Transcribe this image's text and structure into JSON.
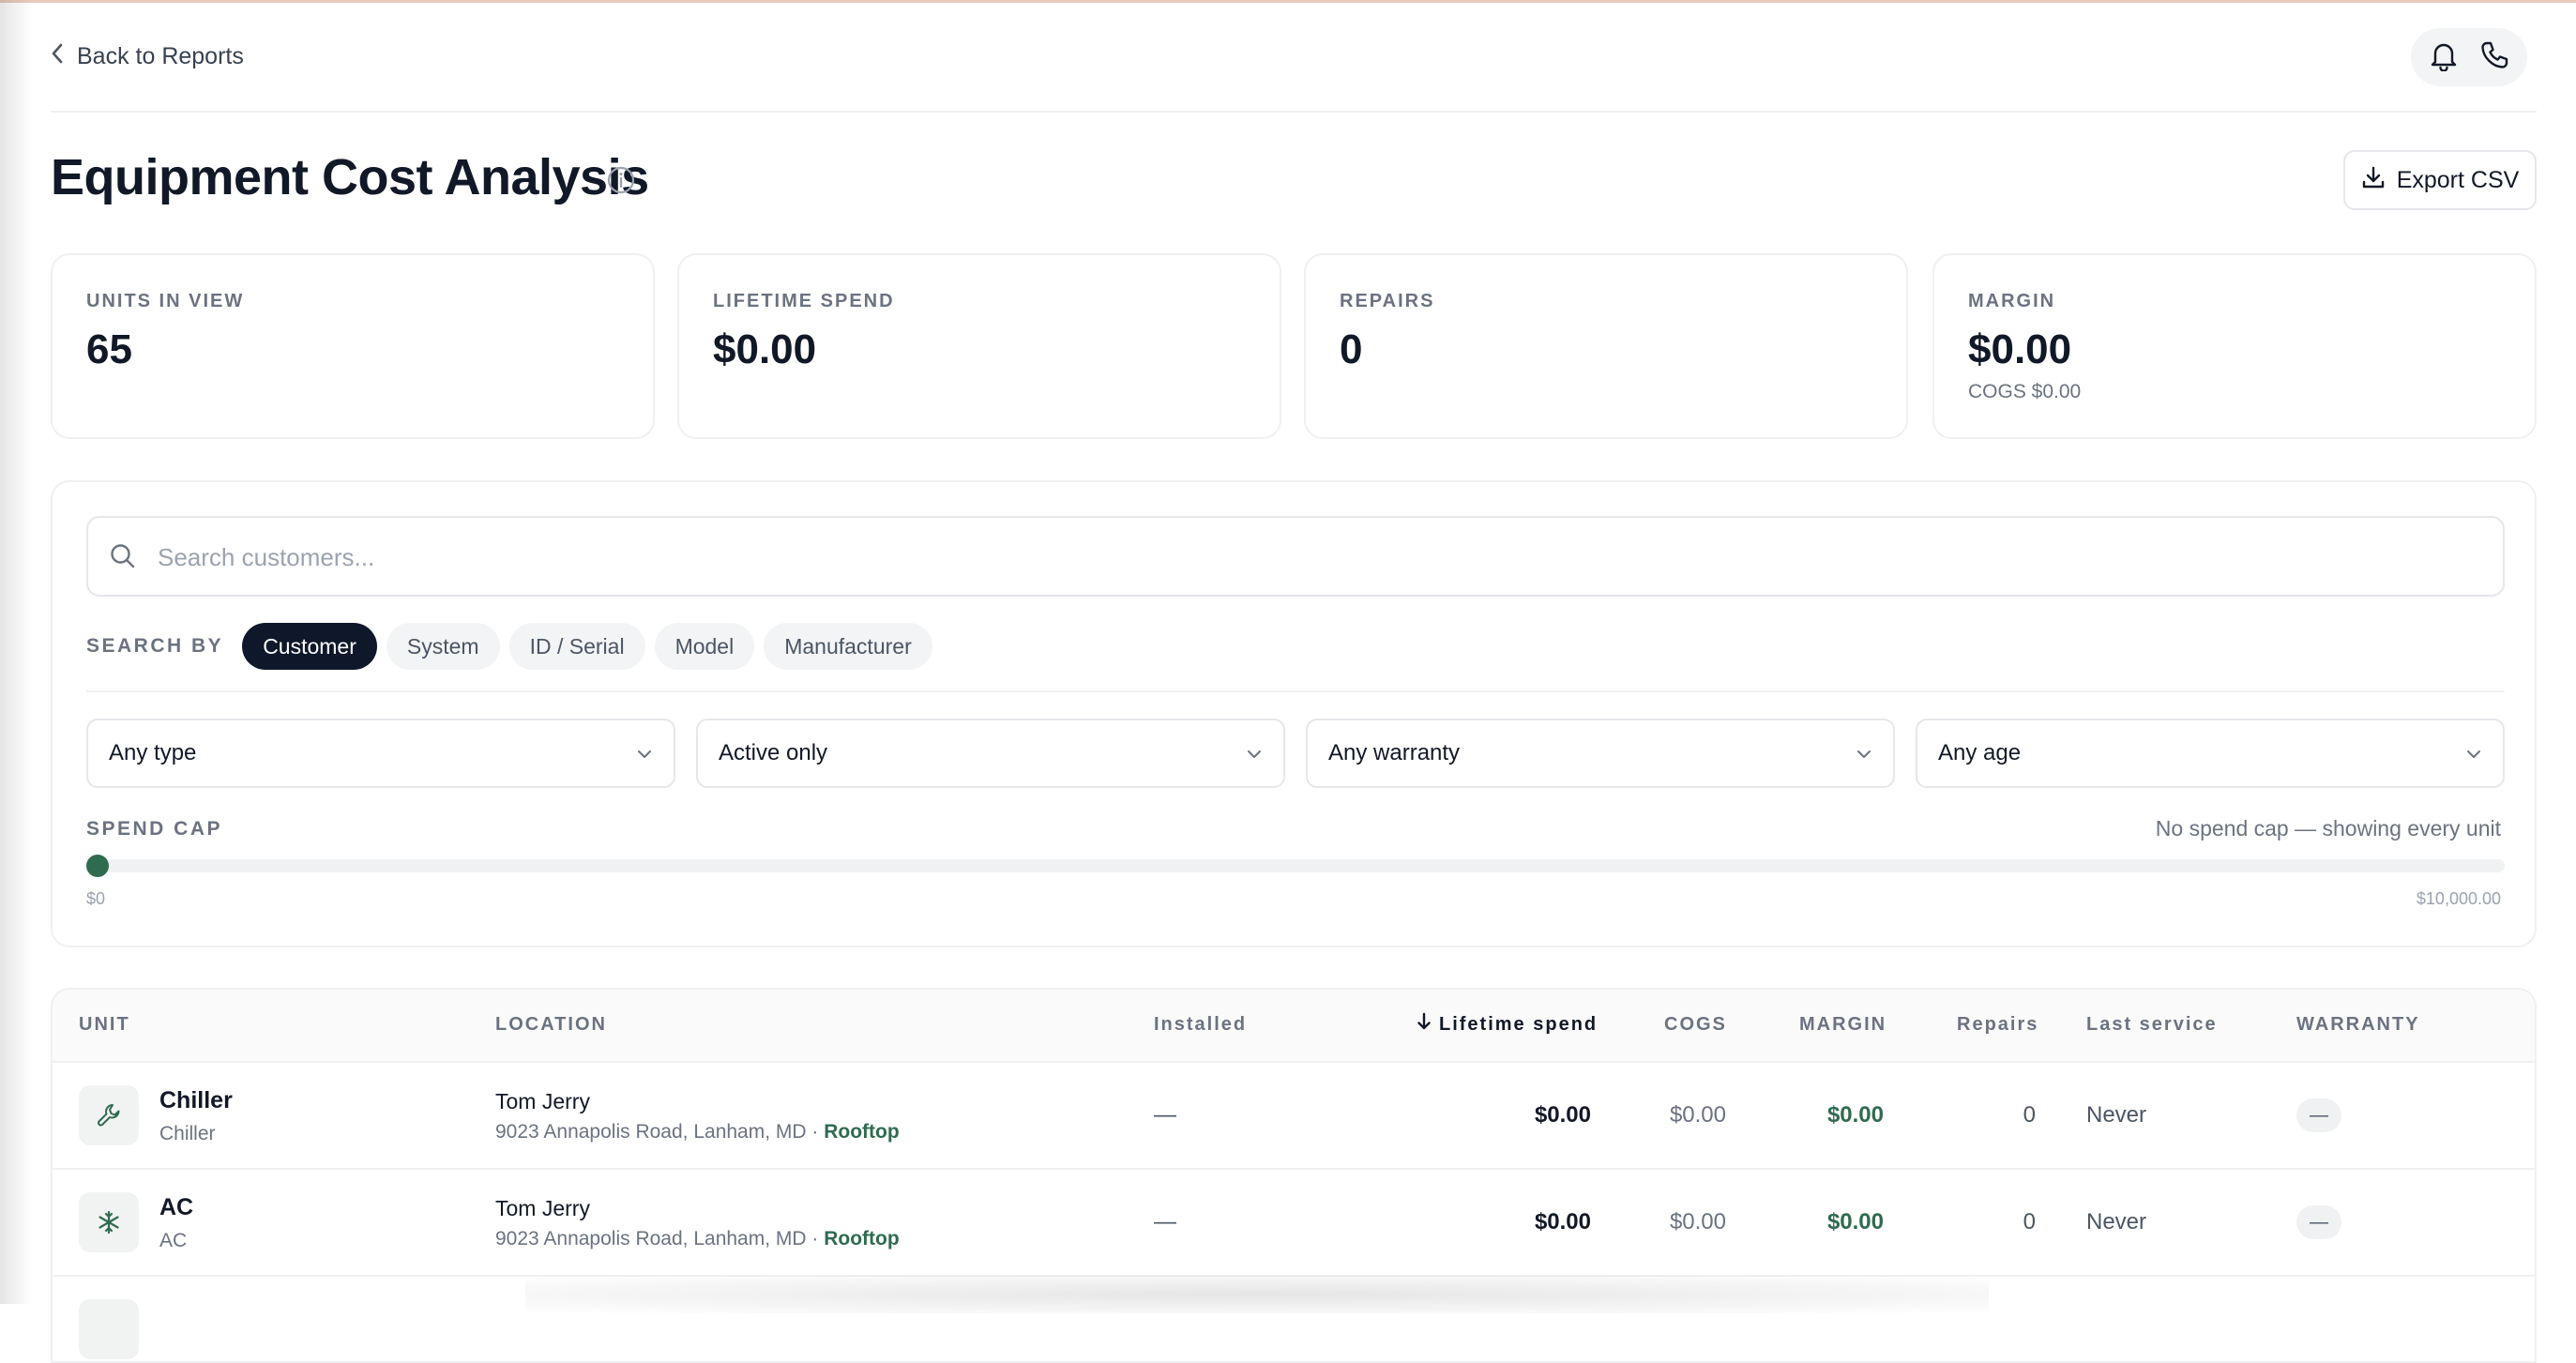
{
  "header": {
    "back_label": "Back to Reports"
  },
  "page": {
    "title": "Equipment Cost Analysis",
    "export_label": "Export CSV"
  },
  "stats": [
    {
      "label": "UNITS IN VIEW",
      "value": "65",
      "sub": ""
    },
    {
      "label": "LIFETIME SPEND",
      "value": "$0.00",
      "sub": ""
    },
    {
      "label": "REPAIRS",
      "value": "0",
      "sub": ""
    },
    {
      "label": "MARGIN",
      "value": "$0.00",
      "sub": "COGS $0.00"
    }
  ],
  "filters": {
    "search_placeholder": "Search customers...",
    "search_by_label": "SEARCH BY",
    "search_by_options": [
      "Customer",
      "System",
      "ID / Serial",
      "Model",
      "Manufacturer"
    ],
    "search_by_selected": "Customer",
    "selects": [
      "Any type",
      "Active only",
      "Any warranty",
      "Any age"
    ],
    "spend_cap_label": "SPEND CAP",
    "spend_cap_note": "No spend cap — showing every unit",
    "spend_cap_value": 0,
    "slider_min": "$0",
    "slider_max": "$10,000.00"
  },
  "table": {
    "columns": [
      "UNIT",
      "LOCATION",
      "Installed",
      "Lifetime spend",
      "COGS",
      "MARGIN",
      "Repairs",
      "Last service",
      "WARRANTY"
    ],
    "sorted_column": "Lifetime spend",
    "rows": [
      {
        "unit": "Chiller",
        "type": "Chiller",
        "icon": "wrench-icon",
        "customer": "Tom Jerry",
        "address": "9023 Annapolis Road, Lanham, MD · ",
        "tag": "Rooftop",
        "installed": "—",
        "spend": "$0.00",
        "cogs": "$0.00",
        "margin": "$0.00",
        "repairs": "0",
        "last_service": "Never",
        "warranty": "—"
      },
      {
        "unit": "AC",
        "type": "AC",
        "icon": "snowflake-icon",
        "customer": "Tom Jerry",
        "address": "9023 Annapolis Road, Lanham, MD · ",
        "tag": "Rooftop",
        "installed": "—",
        "spend": "$0.00",
        "cogs": "$0.00",
        "margin": "$0.00",
        "repairs": "0",
        "last_service": "Never",
        "warranty": "—"
      }
    ]
  },
  "colors": {
    "accent_green": "#2f6b4f",
    "chip_active": "#0f172a"
  }
}
